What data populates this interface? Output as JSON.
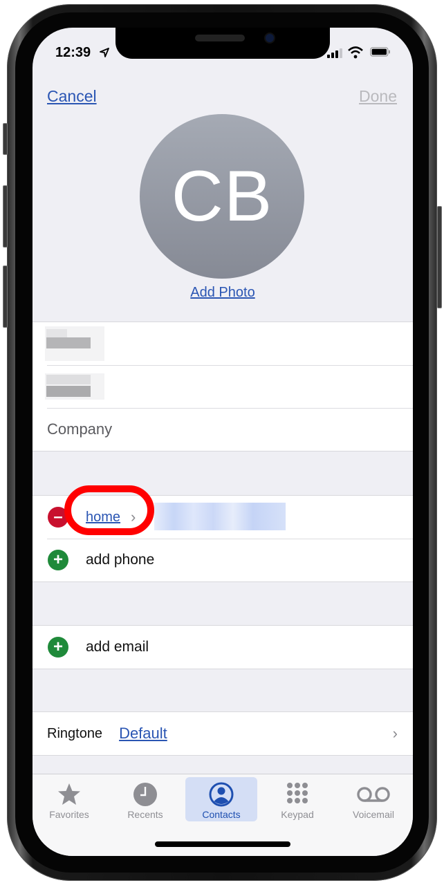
{
  "status_bar": {
    "time": "12:39",
    "location_icon": "location-arrow-icon",
    "signal_icon": "cellular-signal-icon",
    "wifi_icon": "wifi-icon",
    "battery_icon": "battery-icon"
  },
  "nav": {
    "cancel_label": "Cancel",
    "done_label": "Done"
  },
  "contact": {
    "initials": "CB",
    "add_photo_label": "Add Photo"
  },
  "name_fields": {
    "first_name": "",
    "last_name": "",
    "company_placeholder": "Company"
  },
  "phone_section": {
    "phone_label": "home",
    "phone_value": "",
    "remove_icon": "minus-circle-icon",
    "add_phone_label": "add phone",
    "add_icon": "plus-circle-icon"
  },
  "email_section": {
    "add_email_label": "add email"
  },
  "ringtone": {
    "label": "Ringtone",
    "value": "Default"
  },
  "tabbar": {
    "active": "Contacts",
    "tabs": [
      {
        "label": "Favorites",
        "icon": "star-icon"
      },
      {
        "label": "Recents",
        "icon": "clock-icon"
      },
      {
        "label": "Contacts",
        "icon": "person-circle-icon"
      },
      {
        "label": "Keypad",
        "icon": "keypad-icon"
      },
      {
        "label": "Voicemail",
        "icon": "voicemail-icon"
      }
    ]
  },
  "annotation": {
    "highlight_color": "#ff0000",
    "target": "home"
  },
  "colors": {
    "accent": "#2a55b3",
    "remove": "#c8102e",
    "add": "#1f8a3a",
    "background": "#efeff4"
  }
}
